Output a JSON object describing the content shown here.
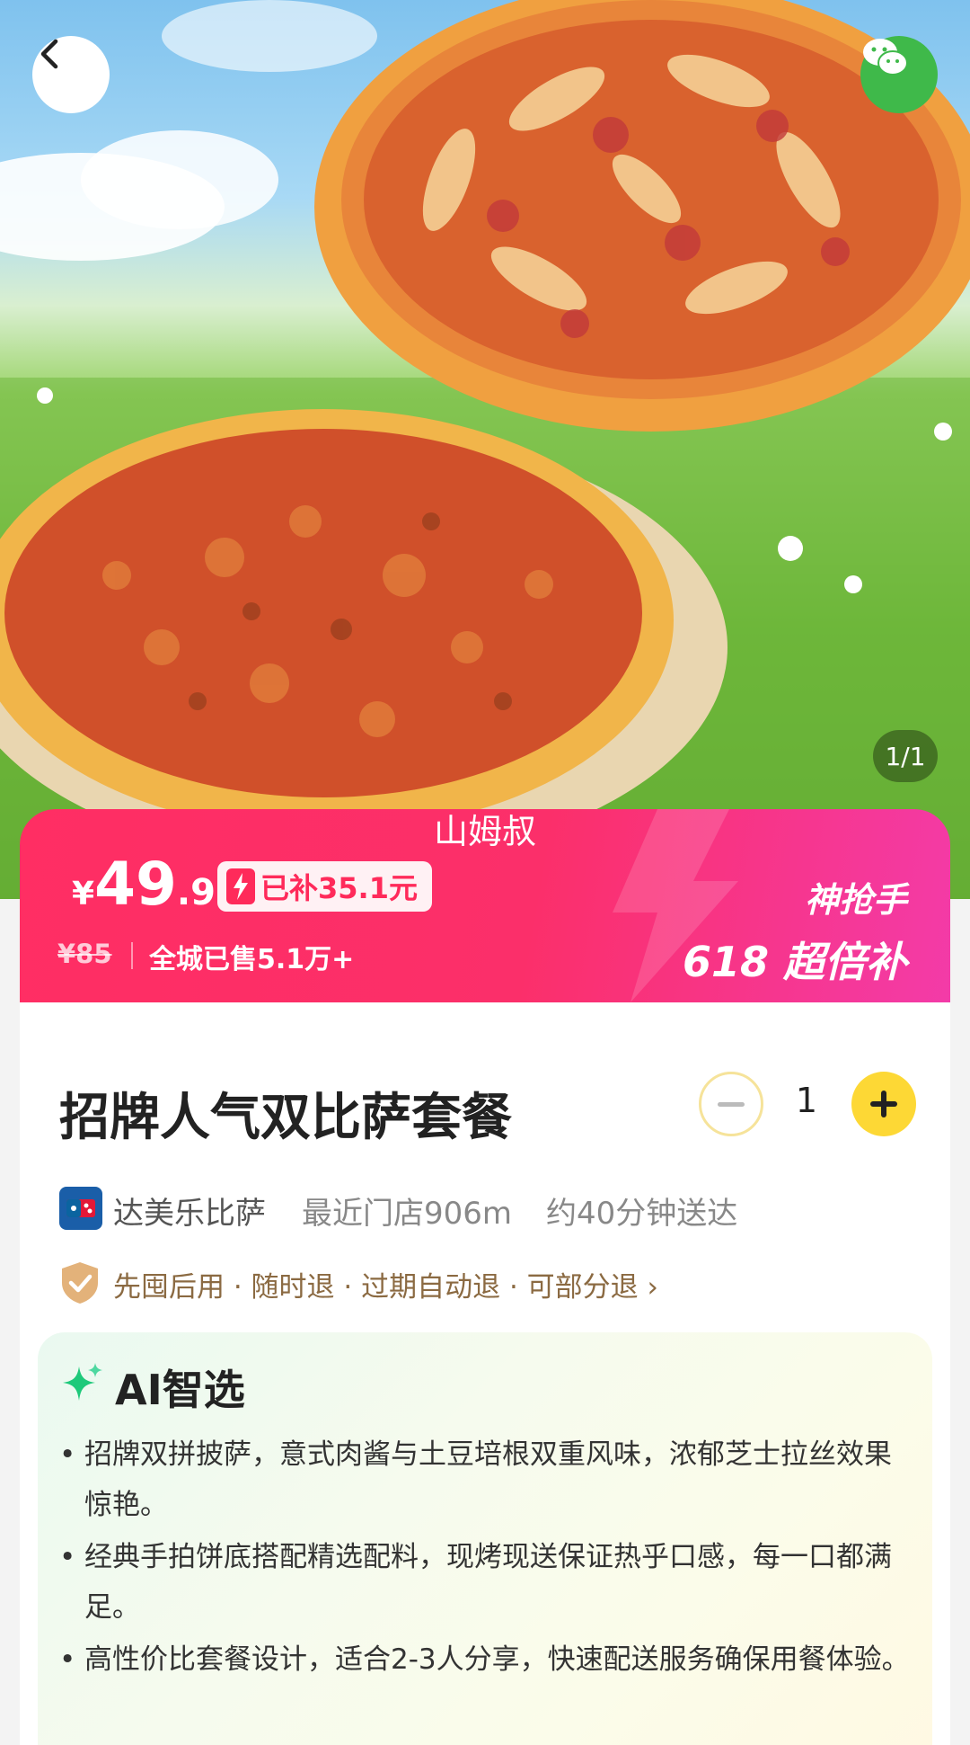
{
  "gallery": {
    "counter": "1/1",
    "watermark": "山姆叔"
  },
  "price_banner": {
    "currency": "¥",
    "price_integer": "49",
    "price_decimal": ".9",
    "subsidy_label": "已补35.1元",
    "original_price": "¥85",
    "sold_text": "全城已售5.1万+",
    "badge_top": "神抢手",
    "badge_bottom": "618 超倍补"
  },
  "product": {
    "title": "招牌人气双比萨套餐",
    "quantity": "1"
  },
  "store": {
    "name": "达美乐比萨",
    "distance": "最近门店906m",
    "delivery_time": "约40分钟送达"
  },
  "policy": {
    "text": "先囤后用 · 随时退 · 过期自动退 · 可部分退 ›"
  },
  "ai_select": {
    "title": "AI智选",
    "bullets": [
      "招牌双拼披萨，意式肉酱与土豆培根双重风味，浓郁芝士拉丝效果惊艳。",
      "经典手拍饼底搭配精选配料，现烤现送保证热乎口感，每一口都满足。",
      "高性价比套餐设计，适合2-3人分享，快速配送服务确保用餐体验。"
    ]
  },
  "colors": {
    "banner_start": "#ff2e63",
    "banner_end": "#f33ba8",
    "accent_yellow": "#fdd835",
    "wechat_green": "#3fb94a",
    "policy_brown": "#8b6a42"
  },
  "icons": [
    "back-arrow-icon",
    "wechat-icon",
    "bolt-icon",
    "minus-icon",
    "plus-icon",
    "dominos-logo-icon",
    "shield-check-icon",
    "sparkle-icon"
  ]
}
